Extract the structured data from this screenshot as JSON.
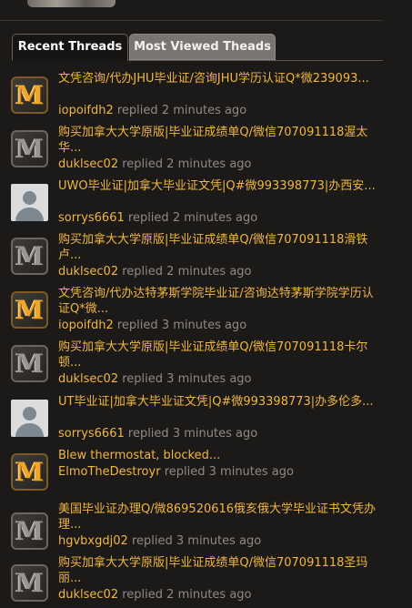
{
  "tabs": {
    "recent": "Recent Threads",
    "most_viewed": "Most Viewed Theads"
  },
  "replied_word": "replied",
  "threads": [
    {
      "avatar": "m-orange",
      "title": "文凭咨询/代办JHU毕业证/咨询JHU学历认证Q*微239093...",
      "user": "iopoifdh2",
      "time": "2 minutes ago"
    },
    {
      "avatar": "m-gray",
      "title": "购买加拿大大学原版|毕业证成绩单Q/微信707091118渥太华...",
      "user": "duklsec02",
      "time": "2 minutes ago"
    },
    {
      "avatar": "person",
      "title": "UWO毕业证|加拿大毕业证文凭|Q#微993398773|办西安...",
      "user": "sorrys6661",
      "time": "2 minutes ago"
    },
    {
      "avatar": "m-gray",
      "title": "购买加拿大大学原版|毕业证成绩单Q/微信707091118滑铁卢...",
      "user": "duklsec02",
      "time": "2 minutes ago"
    },
    {
      "avatar": "m-orange",
      "title": "文凭咨询/代办达特茅斯学院毕业证/咨询达特茅斯学院学历认证Q*微...",
      "user": "iopoifdh2",
      "time": "3 minutes ago"
    },
    {
      "avatar": "m-gray",
      "title": "购买加拿大大学原版|毕业证成绩单Q/微信707091118卡尔顿...",
      "user": "duklsec02",
      "time": "3 minutes ago"
    },
    {
      "avatar": "person",
      "title": "UT毕业证|加拿大毕业证文凭|Q#微993398773|办多伦多...",
      "user": "sorrys6661",
      "time": "3 minutes ago"
    },
    {
      "avatar": "m-orange",
      "title": "Blew thermostat, blocked...",
      "user": "ElmoTheDestroyr",
      "time": "3 minutes ago"
    },
    {
      "avatar": "m-gray",
      "title": "美国毕业证办理Q/微869520616俄亥俄大学毕业证书文凭办理...",
      "user": "hgvbxgdj02",
      "time": "3 minutes ago"
    },
    {
      "avatar": "m-gray",
      "title": "购买加拿大大学原版|毕业证成绩单Q/微信707091118圣玛丽...",
      "user": "duklsec02",
      "time": "2 minutes ago"
    }
  ]
}
